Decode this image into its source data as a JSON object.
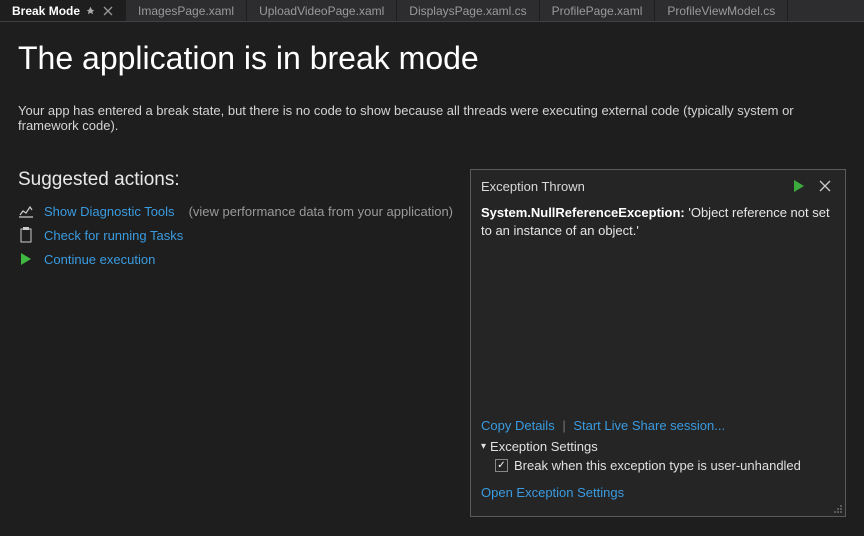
{
  "tabs": [
    {
      "label": "Break Mode",
      "active": true,
      "pinned": true,
      "closable": true
    },
    {
      "label": "ImagesPage.xaml"
    },
    {
      "label": "UploadVideoPage.xaml"
    },
    {
      "label": "DisplaysPage.xaml.cs"
    },
    {
      "label": "ProfilePage.xaml"
    },
    {
      "label": "ProfileViewModel.cs"
    }
  ],
  "heading": "The application is in break mode",
  "message": "Your app has entered a break state, but there is no code to show because all threads were executing external code (typically system or framework code).",
  "suggested": {
    "title": "Suggested actions:",
    "items": [
      {
        "id": "diag",
        "label": "Show Diagnostic Tools",
        "hint": "(view performance data from your application)"
      },
      {
        "id": "tasks",
        "label": "Check for running Tasks"
      },
      {
        "id": "continue",
        "label": "Continue execution"
      }
    ]
  },
  "exception": {
    "title": "Exception Thrown",
    "type": "System.NullReferenceException:",
    "text": "'Object reference not set to an instance of an object.'",
    "copy": "Copy Details",
    "liveshare": "Start Live Share session...",
    "settings_header": "Exception Settings",
    "checkbox_label": "Break when this exception type is user-unhandled",
    "open_settings": "Open Exception Settings"
  }
}
